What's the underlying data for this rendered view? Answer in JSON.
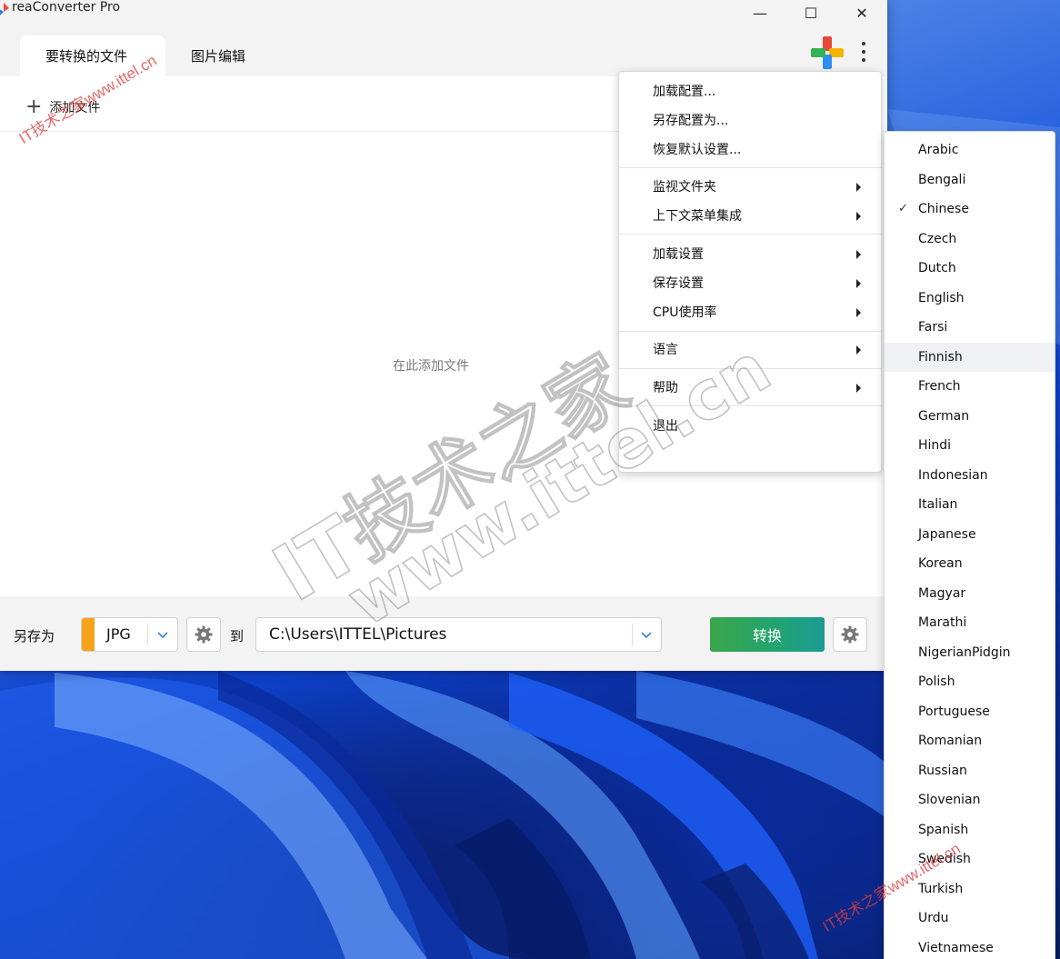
{
  "window": {
    "title": "reaConverter Pro",
    "minimize_glyph": "—",
    "maximize_glyph": "☐",
    "close_glyph": "✕"
  },
  "tabs": [
    {
      "label": "要转换的文件",
      "active": true
    },
    {
      "label": "图片编辑",
      "active": false
    }
  ],
  "content": {
    "add_files_label": "添加文件",
    "drop_hint": "在此添加文件"
  },
  "bottom_bar": {
    "save_as_label": "另存为",
    "format_value": "JPG",
    "format_accent": "#f7a21b",
    "to_label": "到",
    "output_path": "C:\\Users\\ITTEL\\Pictures",
    "convert_label": "转换"
  },
  "menu": {
    "groups": [
      [
        "加载配置...",
        "另存配置为...",
        "恢复默认设置..."
      ],
      [
        "监视文件夹",
        "上下文菜单集成"
      ],
      [
        "加载设置",
        "保存设置",
        "CPU使用率"
      ],
      [
        "语言"
      ],
      [
        "帮助"
      ],
      [
        "退出"
      ]
    ],
    "items": {
      "load_config": "加载配置...",
      "save_config_as": "另存配置为...",
      "restore_defaults": "恢复默认设置...",
      "watch_folder": "监视文件夹",
      "context_menu": "上下文菜单集成",
      "load_settings": "加载设置",
      "save_settings": "保存设置",
      "cpu_usage": "CPU使用率",
      "language": "语言",
      "help": "帮助",
      "exit": "退出"
    }
  },
  "languages": {
    "selected": "Chinese",
    "hovered": "Finnish",
    "check_glyph": "✓",
    "items": [
      "Arabic",
      "Bengali",
      "Chinese",
      "Czech",
      "Dutch",
      "English",
      "Farsi",
      "Finnish",
      "French",
      "German",
      "Hindi",
      "Indonesian",
      "Italian",
      "Japanese",
      "Korean",
      "Magyar",
      "Marathi",
      "NigerianPidgin",
      "Polish",
      "Portuguese",
      "Romanian",
      "Russian",
      "Slovenian",
      "Spanish",
      "Swedish",
      "Turkish",
      "Urdu",
      "Vietnamese"
    ]
  },
  "watermarks": {
    "small": "IT技术之家www.ittel.cn",
    "big_line1": "IT技术之家",
    "big_line2": "www.ittel.cn",
    "small_color": "#e23c3c"
  },
  "icons": {
    "app_logo": "reaconverter-logo-icon",
    "brand_logo": "colorful-plus-logo-icon",
    "more": "vertical-ellipsis-icon",
    "add": "plus-icon",
    "dropdown": "chevron-down-icon",
    "settings": "gear-icon",
    "submenu": "submenu-arrow-icon",
    "check": "check-icon"
  }
}
